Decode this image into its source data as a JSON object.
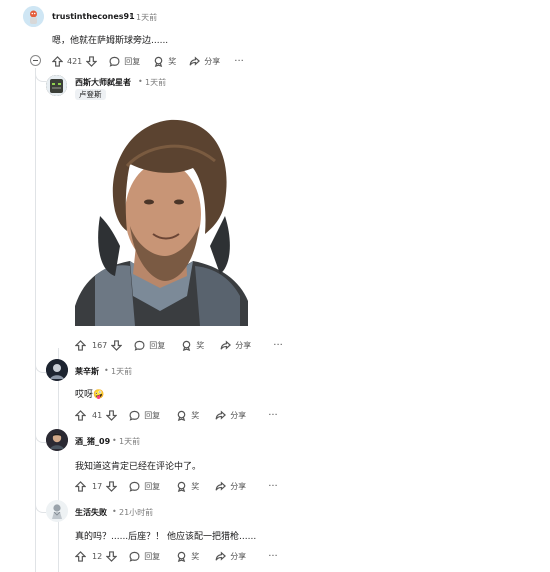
{
  "root": {
    "username": "trustinthecones91",
    "time": "1天前",
    "text": "嗯，他就在萨姆斯球旁边......",
    "votes": "421"
  },
  "labels": {
    "reply": "回复",
    "award": "奖",
    "share": "分享",
    "more": "···",
    "dot": "•"
  },
  "replies": [
    {
      "username": "西斯大师弑星者",
      "time": "1天前",
      "flair": "卢登斯",
      "votes": "167",
      "has_image": true
    },
    {
      "username": "莱辛斯",
      "time": "1天前",
      "text": "哎呀🤪",
      "votes": "41"
    },
    {
      "username": "酒_猪_09",
      "time": "1天前",
      "text": "我知道这肯定已经在评论中了。",
      "votes": "17"
    },
    {
      "username": "生活失败",
      "time": "21小时前",
      "text": "真的吗？......后座？！ 他应该配一把猎枪......",
      "votes": "12"
    }
  ],
  "colors": {
    "thread": "#e0e3e6",
    "meta": "#7c7c7c",
    "text": "#1a1a1b"
  }
}
